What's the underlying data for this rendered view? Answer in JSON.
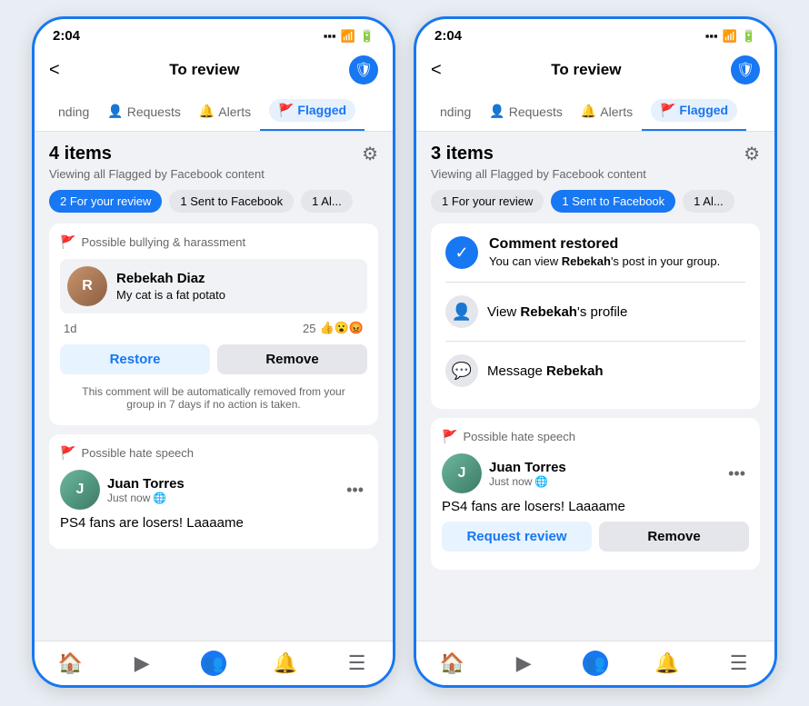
{
  "phones": [
    {
      "id": "phone-left",
      "status_time": "2:04",
      "nav_title": "To review",
      "back_label": "<",
      "tabs": [
        {
          "label": "nding",
          "icon": "",
          "active": false
        },
        {
          "label": "Requests",
          "icon": "👤",
          "active": false
        },
        {
          "label": "Alerts",
          "icon": "🔔",
          "active": false
        },
        {
          "label": "Flagged",
          "icon": "🚩",
          "active": true
        }
      ],
      "items_count": "4 items",
      "viewing_text": "Viewing all Flagged by Facebook content",
      "chips": [
        {
          "label": "2 For your review",
          "type": "blue"
        },
        {
          "label": "1 Sent to Facebook",
          "type": "gray"
        },
        {
          "label": "1 Al...",
          "type": "gray"
        }
      ],
      "cards": [
        {
          "type": "review",
          "flag_label": "Possible bullying & harassment",
          "user_name": "Rebekah Diaz",
          "user_comment": "My cat is a fat potato",
          "time": "1d",
          "reactions_count": "25",
          "reactions_emoji": "👍😮😡",
          "btn1": "Restore",
          "btn1_type": "blue",
          "btn2": "Remove",
          "btn2_type": "gray",
          "auto_text": "This comment will be automatically removed from your group in 7 days if no action is taken."
        },
        {
          "type": "post",
          "flag_label": "Possible hate speech",
          "user_name": "Juan Torres",
          "time": "Just now",
          "globe": "🌐",
          "post_text": "PS4 fans are losers! Laaaame"
        }
      ]
    },
    {
      "id": "phone-right",
      "status_time": "2:04",
      "nav_title": "To review",
      "back_label": "<",
      "tabs": [
        {
          "label": "nding",
          "icon": "",
          "active": false
        },
        {
          "label": "Requests",
          "icon": "👤",
          "active": false
        },
        {
          "label": "Alerts",
          "icon": "🔔",
          "active": false
        },
        {
          "label": "Flagged",
          "icon": "🚩",
          "active": true
        }
      ],
      "items_count": "3 items",
      "viewing_text": "Viewing all Flagged by Facebook content",
      "chips": [
        {
          "label": "1 For your review",
          "type": "gray"
        },
        {
          "label": "1 Sent to Facebook",
          "type": "blue"
        },
        {
          "label": "1 Al...",
          "type": "gray"
        }
      ],
      "restored_card": {
        "title": "Comment restored",
        "text_part1": "You can view ",
        "bold1": "Rebekah",
        "text_part2": "'s post in your group.",
        "link1_icon": "👤",
        "link1_text_pre": "View ",
        "link1_bold": "Rebekah",
        "link1_text_post": "'s profile",
        "link2_icon": "💬",
        "link2_text_pre": "Message ",
        "link2_bold": "Rebekah"
      },
      "cards": [
        {
          "type": "post",
          "flag_label": "Possible hate speech",
          "user_name": "Juan Torres",
          "time": "Just now",
          "globe": "🌐",
          "post_text": "PS4 fans are losers! Laaaame",
          "btn1": "Request review",
          "btn1_type": "blue",
          "btn2": "Remove",
          "btn2_type": "gray"
        }
      ]
    }
  ],
  "bottom_nav": {
    "items": [
      {
        "icon": "🏠",
        "label": "home"
      },
      {
        "icon": "▶",
        "label": "video"
      },
      {
        "icon": "👥",
        "label": "groups",
        "active": true
      },
      {
        "icon": "🔔",
        "label": "notifications"
      },
      {
        "icon": "☰",
        "label": "menu"
      }
    ]
  }
}
